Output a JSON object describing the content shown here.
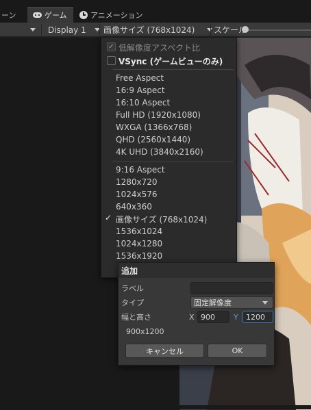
{
  "tabs": [
    {
      "label": "ーン"
    },
    {
      "label": "ゲーム",
      "icon": "gamepad-icon"
    },
    {
      "label": "アニメーション",
      "icon": "clock-icon"
    }
  ],
  "toolbar": {
    "display_label": "Display 1",
    "resolution_label": "画像サイズ (768x1024)",
    "scale_label": "スケール"
  },
  "menu": {
    "aspect_option": "低解像度アスペクト比",
    "vsync_option": "VSync (ゲームビューのみ)",
    "group1": [
      "Free Aspect",
      "16:9 Aspect",
      "16:10 Aspect",
      "Full HD (1920x1080)",
      "WXGA (1366x768)",
      "QHD (2560x1440)",
      "4K UHD (3840x2160)"
    ],
    "group2": [
      "9:16 Aspect",
      "1280x720",
      "1024x576",
      "640x360",
      "画像サイズ (768x1024)",
      "1536x1024",
      "1024x1280",
      "1536x1920"
    ],
    "check_mark": "✓"
  },
  "popup": {
    "title": "追加",
    "label_label": "ラベル",
    "label_value": "",
    "type_label": "タイプ",
    "type_value": "固定解像度",
    "size_label": "幅と高さ",
    "x_label": "X",
    "x_value": "900",
    "y_label": "Y",
    "y_value": "1200",
    "size_text": "900x1200",
    "cancel": "キャンセル",
    "ok": "OK"
  }
}
